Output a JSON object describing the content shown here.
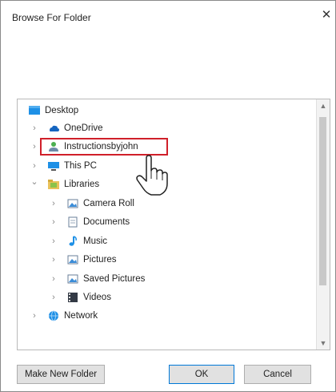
{
  "window": {
    "title": "Browse For Folder",
    "close_glyph": "✕"
  },
  "tree": {
    "items": [
      {
        "label": "Desktop",
        "icon": "desktop-icon",
        "chevron": ""
      },
      {
        "label": "OneDrive",
        "icon": "cloud-icon",
        "chevron": "›"
      },
      {
        "label": "Instructionsbyjohn",
        "icon": "user-folder-icon",
        "chevron": "›"
      },
      {
        "label": "This PC",
        "icon": "computer-icon",
        "chevron": "›"
      },
      {
        "label": "Libraries",
        "icon": "library-icon",
        "chevron": "⌄"
      },
      {
        "label": "Camera Roll",
        "icon": "pictures-icon",
        "chevron": "›"
      },
      {
        "label": "Documents",
        "icon": "documents-icon",
        "chevron": "›"
      },
      {
        "label": "Music",
        "icon": "music-icon",
        "chevron": "›"
      },
      {
        "label": "Pictures",
        "icon": "pictures-icon",
        "chevron": "›"
      },
      {
        "label": "Saved Pictures",
        "icon": "pictures-icon",
        "chevron": "›"
      },
      {
        "label": "Videos",
        "icon": "videos-icon",
        "chevron": "›"
      },
      {
        "label": "Network",
        "icon": "network-icon",
        "chevron": "›"
      }
    ],
    "scroll_up": "▲",
    "scroll_down": "▼"
  },
  "buttons": {
    "make_new_folder": "Make New Folder",
    "ok": "OK",
    "cancel": "Cancel"
  },
  "colors": {
    "highlight": "#d0202a",
    "primary_border": "#0078d7"
  }
}
